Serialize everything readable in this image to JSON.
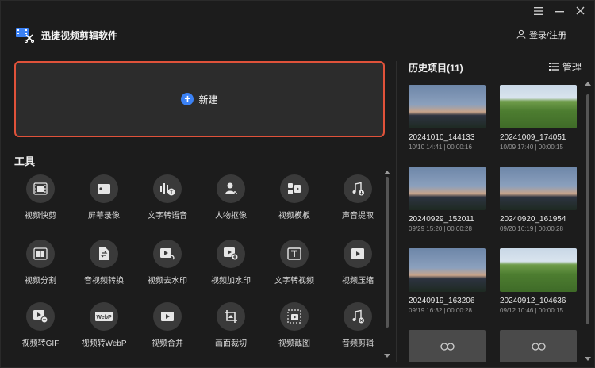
{
  "app": {
    "title": "迅捷视频剪辑软件"
  },
  "header": {
    "login_label": "登录/注册"
  },
  "new_project": {
    "label": "新建"
  },
  "tools": {
    "title": "工具",
    "items": [
      {
        "label": "视频快剪",
        "icon": "film-strip-icon"
      },
      {
        "label": "屏幕录像",
        "icon": "screen-record-icon"
      },
      {
        "label": "文字转语音",
        "icon": "text-to-speech-icon"
      },
      {
        "label": "人物抠像",
        "icon": "person-cutout-icon"
      },
      {
        "label": "视频模板",
        "icon": "template-icon"
      },
      {
        "label": "声音提取",
        "icon": "music-extract-icon"
      },
      {
        "label": "视频分割",
        "icon": "split-icon"
      },
      {
        "label": "音视频转换",
        "icon": "convert-icon"
      },
      {
        "label": "视频去水印",
        "icon": "remove-watermark-icon"
      },
      {
        "label": "视频加水印",
        "icon": "add-watermark-icon"
      },
      {
        "label": "文字转视频",
        "icon": "text-to-video-icon"
      },
      {
        "label": "视频压缩",
        "icon": "compress-icon"
      },
      {
        "label": "视频转GIF",
        "icon": "gif-icon"
      },
      {
        "label": "视频转WebP",
        "icon": "webp-icon"
      },
      {
        "label": "视频合并",
        "icon": "merge-icon"
      },
      {
        "label": "画面裁切",
        "icon": "crop-icon"
      },
      {
        "label": "视频截图",
        "icon": "screenshot-icon"
      },
      {
        "label": "音频剪辑",
        "icon": "audio-edit-icon"
      }
    ]
  },
  "history": {
    "title": "历史项目(11)",
    "manage_label": "管理",
    "items": [
      {
        "name": "20241010_144133",
        "meta": "10/10 14:41 | 00:00:16",
        "thumb": "sunset"
      },
      {
        "name": "20241009_174051",
        "meta": "10/09 17:40 | 00:00:15",
        "thumb": "field"
      },
      {
        "name": "20240929_152011",
        "meta": "09/29 15:20 | 00:00:28",
        "thumb": "sunset"
      },
      {
        "name": "20240920_161954",
        "meta": "09/20 16:19 | 00:00:28",
        "thumb": "sunset"
      },
      {
        "name": "20240919_163206",
        "meta": "09/19 16:32 | 00:00:28",
        "thumb": "sunset"
      },
      {
        "name": "20240912_104636",
        "meta": "09/12 10:46 | 00:00:15",
        "thumb": "field"
      },
      {
        "name": "",
        "meta": "",
        "thumb": "empty"
      },
      {
        "name": "",
        "meta": "",
        "thumb": "empty"
      }
    ]
  },
  "colors": {
    "accent_border": "#e0523a",
    "accent_blue": "#3b82f6",
    "background": "#1c1c1c"
  }
}
